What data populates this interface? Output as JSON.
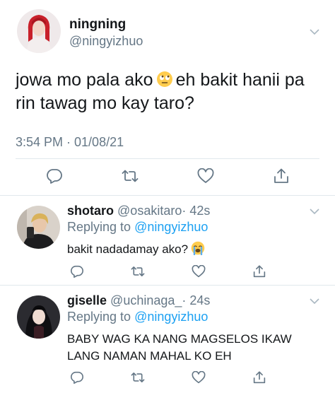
{
  "main_tweet": {
    "display_name": "ningning",
    "handle": "@ningyizhuo",
    "text_before_emoji": "jowa mo pala ako",
    "emoji": "face-with-rolling-eyes",
    "text_after_emoji": "eh bakit hanii pa rin tawag mo kay taro?",
    "timestamp": "3:54 PM · 01/08/21"
  },
  "replies": [
    {
      "display_name": "shotaro",
      "handle": "@osakitaro",
      "time": "· 42s",
      "replying_prefix": "Replying to",
      "replying_handle": "@ningyizhuo",
      "text": "bakit nadadamay ako?",
      "emoji": "loudly-crying-face"
    },
    {
      "display_name": "giselle",
      "handle": "@uchinaga_",
      "time": "· 24s",
      "replying_prefix": "Replying to",
      "replying_handle": "@ningyizhuo",
      "text": "BABY WAG KA NANG MAGSELOS IKAW LANG NAMAN MAHAL KO EH"
    }
  ],
  "actions": [
    "reply-icon",
    "retweet-icon",
    "like-icon",
    "share-icon"
  ],
  "colors": {
    "text": "#14171a",
    "secondary": "#657786",
    "link": "#1da1f2",
    "divider": "#e1e8ed"
  }
}
